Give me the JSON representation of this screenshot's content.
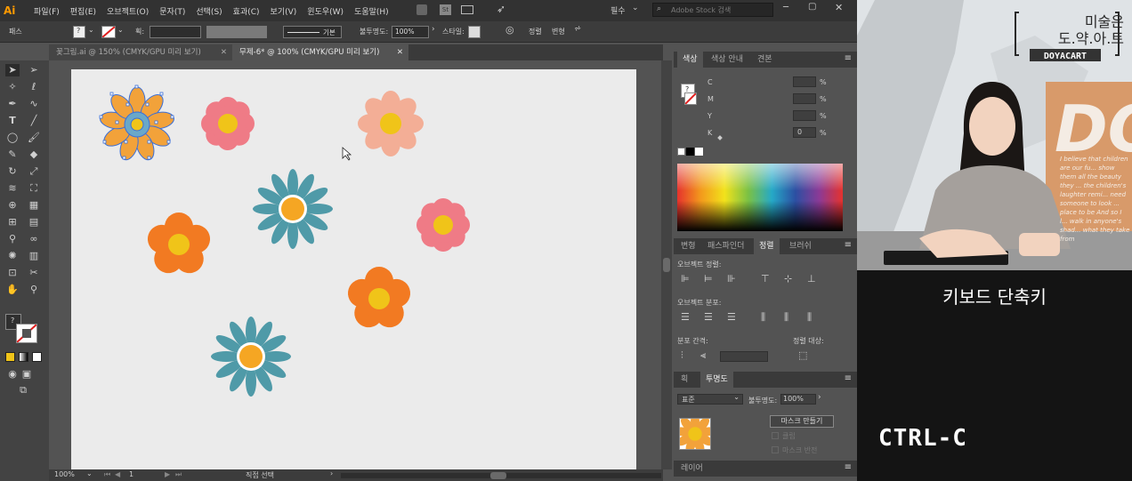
{
  "app": {
    "logo": "Ai"
  },
  "menu": [
    "파일(F)",
    "편집(E)",
    "오브젝트(O)",
    "문자(T)",
    "선택(S)",
    "효과(C)",
    "보기(V)",
    "윈도우(W)",
    "도움말(H)"
  ],
  "titlebar": {
    "workspace": "필수",
    "search_placeholder": "Adobe Stock 검색"
  },
  "control_bar": {
    "object_label": "패스",
    "stroke_label": "획:",
    "stroke_style": "기본",
    "opacity_label": "불투명도:",
    "opacity_value": "100%",
    "style_label": "스타일:",
    "align_label": "정렬",
    "transform_label": "변형"
  },
  "doc_tabs": [
    {
      "label": "꽃그림.ai @ 150% (CMYK/GPU 미리 보기)",
      "active": false
    },
    {
      "label": "무제-6* @ 100% (CMYK/GPU 미리 보기)",
      "active": true
    }
  ],
  "status": {
    "zoom": "100%",
    "artboard": "1",
    "tool": "직접 선택"
  },
  "color_panel": {
    "tabs": [
      "색상",
      "색상 안내",
      "견본"
    ],
    "channels": [
      "C",
      "M",
      "Y",
      "K"
    ],
    "k_value": "0",
    "percent": "%"
  },
  "align_panel": {
    "tabs": [
      "변형",
      "패스파인더",
      "정렬",
      "브러쉬"
    ],
    "align_objects": "오브젝트 정렬:",
    "distribute_objects": "오브젝트 분포:",
    "distribute_spacing": "분포 간격:",
    "align_to": "정렬 대상:"
  },
  "transparency_panel": {
    "tabs": [
      "획",
      "투명도"
    ],
    "blend_mode": "표준",
    "opacity_label": "불투명도:",
    "opacity_value": "100%",
    "make_mask": "마스크 만들기",
    "clip": "클립",
    "invert_mask": "마스크 반전"
  },
  "layers_panel": {
    "tab": "레이어"
  },
  "colors": {
    "orange": "#f27a22",
    "pink": "#ef7b86",
    "peach": "#f3ae96",
    "teal": "#4f9aa8",
    "yellow": "#f0c419",
    "amber": "#f5a623",
    "selection": "#3a6fd8"
  },
  "flowers": [
    {
      "type": "daisy-selected",
      "petal_color": "#f2a23a",
      "center": "#f0c419"
    },
    {
      "type": "round",
      "petal_color": "#ef7b86",
      "center": "#f0c419"
    },
    {
      "type": "round",
      "petal_color": "#f3ae96",
      "center": "#f0c419"
    },
    {
      "type": "spiky",
      "petal_color": "#4f9aa8",
      "center": "#f5a623"
    },
    {
      "type": "round",
      "petal_color": "#ef7b86",
      "center": "#f0c419"
    },
    {
      "type": "round-large",
      "petal_color": "#f27a22",
      "center": "#f0c419"
    },
    {
      "type": "round-large",
      "petal_color": "#f27a22",
      "center": "#f0c419"
    },
    {
      "type": "spiky",
      "petal_color": "#4f9aa8",
      "center": "#f5a623"
    }
  ],
  "video": {
    "logo_line1": "미술은",
    "logo_line2": "도.약.아.트",
    "logo_brand": "DOYACART",
    "wall_text": "DO",
    "wall_script": "I believe that children are our fu... show them all the beauty they ... the children's laughter remi... need someone to look ... place to be And so I l... walk in anyone's shad... what they take from"
  },
  "caption": {
    "title": "키보드 단축키",
    "shortcut": "CTRL-C"
  }
}
